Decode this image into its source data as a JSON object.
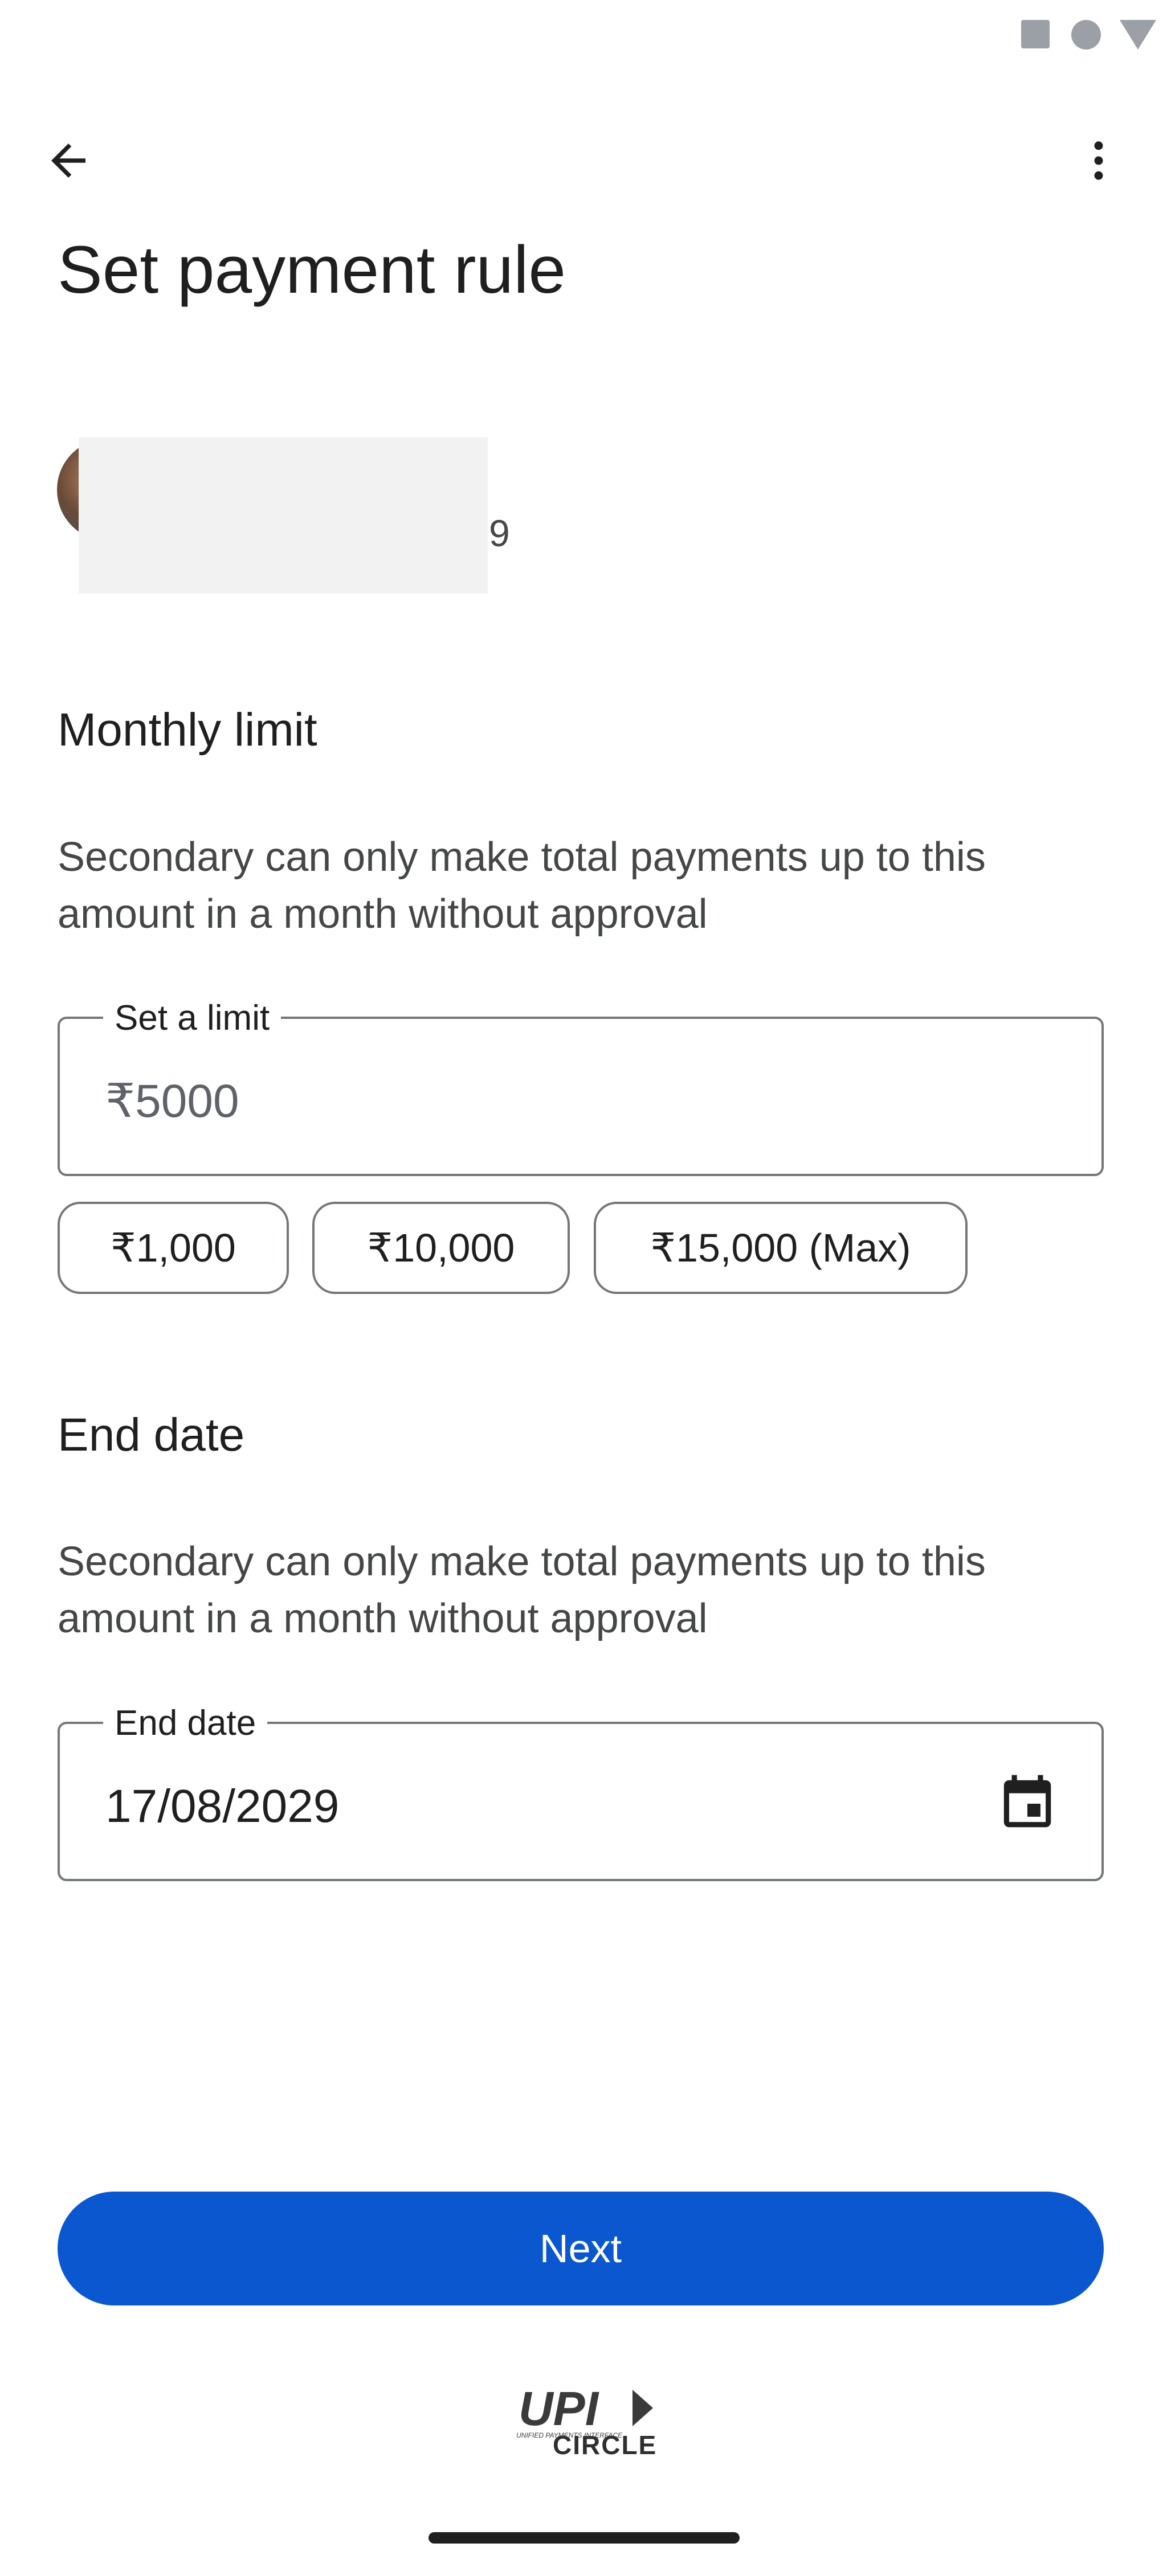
{
  "status_bar": {
    "icons": [
      "square-icon",
      "circle-icon",
      "triangle-icon"
    ]
  },
  "app_bar": {
    "back_icon": "arrow-back-icon",
    "more_icon": "more-vert-icon"
  },
  "page": {
    "title": "Set payment rule"
  },
  "account": {
    "suffix": "9"
  },
  "monthly_limit": {
    "title": "Monthly limit",
    "description": "Secondary can only make total payments up to this amount in a month without approval",
    "field_label": "Set a limit",
    "field_placeholder": "₹5000",
    "chips": [
      {
        "label": "₹1,000"
      },
      {
        "label": "₹10,000"
      },
      {
        "label": "₹15,000 (Max)"
      }
    ]
  },
  "end_date": {
    "title": "End date",
    "description": "Secondary can only make total payments up to this amount in a month without approval",
    "field_label": "End date",
    "field_value": "17/08/2029",
    "calendar_icon": "calendar-icon"
  },
  "actions": {
    "next_label": "Next"
  },
  "footer": {
    "logo_text": "UPI",
    "logo_subtext": "UNIFIED PAYMENTS INTERFACE",
    "circle_text": "CIRCLE"
  },
  "colors": {
    "primary": "#0b57d0",
    "outline": "#747775",
    "text": "#1f1f1f",
    "secondary_text": "#444746"
  }
}
